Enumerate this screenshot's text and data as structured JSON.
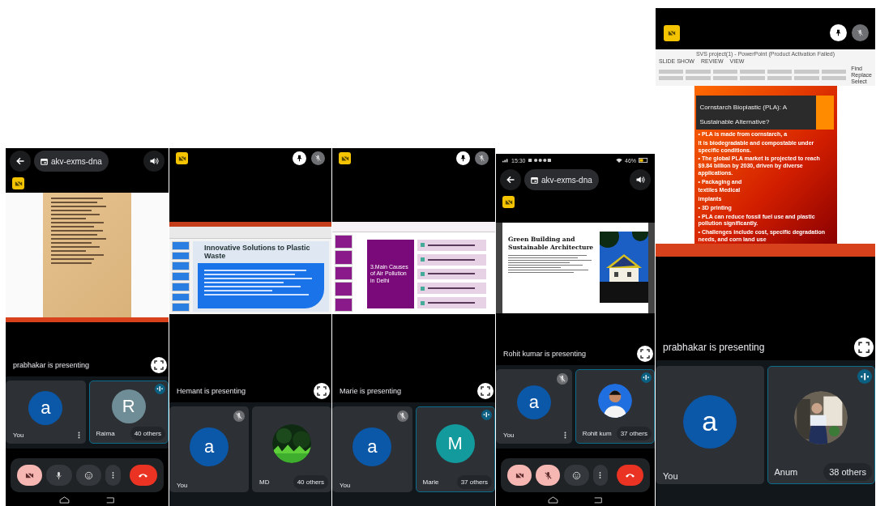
{
  "panels": [
    {
      "header": {
        "kind": "call",
        "meeting_code": "akv-exms-dna"
      },
      "slide": {
        "kind": "notes"
      },
      "presenter": "prabhakar is presenting",
      "tiles": [
        {
          "name": "You",
          "avatar": {
            "kind": "letter",
            "letter": "a",
            "color": "#0b57a8"
          },
          "muted": false,
          "speaking": false,
          "menu": true
        },
        {
          "name": "Raima",
          "avatar": {
            "kind": "letter",
            "letter": "R",
            "color": "#6f8d97"
          },
          "muted": false,
          "speaking": true,
          "menu": false,
          "others": "40 others"
        }
      ],
      "controls": {
        "camera_off": true,
        "mic_off": false
      },
      "nav_bar": true
    },
    {
      "header": {
        "kind": "tile"
      },
      "slide": {
        "kind": "banner",
        "title": "Innovative Solutions to Plastic Waste"
      },
      "presenter": "Hemant is presenting",
      "tiles": [
        {
          "name": "You",
          "avatar": {
            "kind": "letter",
            "letter": "a",
            "color": "#0b57a8"
          },
          "muted": true,
          "speaking": false,
          "menu": false
        },
        {
          "name": "MD",
          "muted": false,
          "speaking": false,
          "menu": false,
          "others": "40 others"
        }
      ]
    },
    {
      "header": {
        "kind": "tile"
      },
      "slide": {
        "kind": "list",
        "title": "3.Main Causes of Air Pollution in Delhi"
      },
      "presenter": "Marie is presenting",
      "tiles": [
        {
          "name": "You",
          "avatar": {
            "kind": "letter",
            "letter": "a",
            "color": "#0b57a8"
          },
          "muted": true,
          "speaking": false,
          "menu": false
        },
        {
          "name": "Marie",
          "avatar": {
            "kind": "letter",
            "letter": "M",
            "color": "#129a9c"
          },
          "muted": false,
          "speaking": true,
          "menu": false,
          "others": "37 others"
        }
      ]
    },
    {
      "status_bar": {
        "time": "15:30",
        "battery": "46%"
      },
      "header": {
        "kind": "call",
        "meeting_code": "akv-exms-dna"
      },
      "slide": {
        "title": "Green Building and Sustainable Architecture"
      },
      "presenter": "Rohit kumar is presenting",
      "tiles": [
        {
          "name": "You",
          "avatar": {
            "kind": "letter",
            "letter": "a",
            "color": "#0b57a8"
          },
          "muted": true,
          "speaking": false,
          "menu": true
        },
        {
          "name": "Rohit kum",
          "muted": false,
          "speaking": true,
          "menu": false,
          "others": "37 others"
        }
      ],
      "controls": {
        "camera_off": true,
        "mic_off": true
      },
      "nav_bar": true
    },
    {
      "header": {
        "kind": "tile"
      },
      "slide": {
        "kind": "bullets",
        "window_title": "SVS project(1) - PowerPoint (Product Activation Failed)",
        "ribbon_tabs": [
          "SLIDE SHOW",
          "REVIEW",
          "VIEW"
        ],
        "editing": [
          "Find",
          "Replace",
          "Select"
        ],
        "title": "Cornstarch Bioplastic (PLA): A Sustainable Alternative?",
        "bullets": [
          "• PLA is made from cornstarch, a",
          "It is biodegradable and compostable under specific conditions.",
          "• The global PLA market is projected to reach $9.84 billion by 2030, driven by diverse applications.",
          "• Packaging and",
          "textiles Medical",
          "implants",
          "• 3D printing",
          "• PLA can reduce fossil fuel use and plastic pollution significantly.",
          "• Challenges include cost, specific degradation needs, and corn land use"
        ]
      },
      "presenter": "prabhakar is presenting",
      "tiles": [
        {
          "name": "You",
          "avatar": {
            "kind": "letter",
            "letter": "a",
            "color": "#0b57a8"
          },
          "muted": false,
          "speaking": false,
          "menu": false
        },
        {
          "name": "Anum",
          "muted": false,
          "speaking": true,
          "menu": false,
          "others": "38 others"
        }
      ]
    }
  ]
}
